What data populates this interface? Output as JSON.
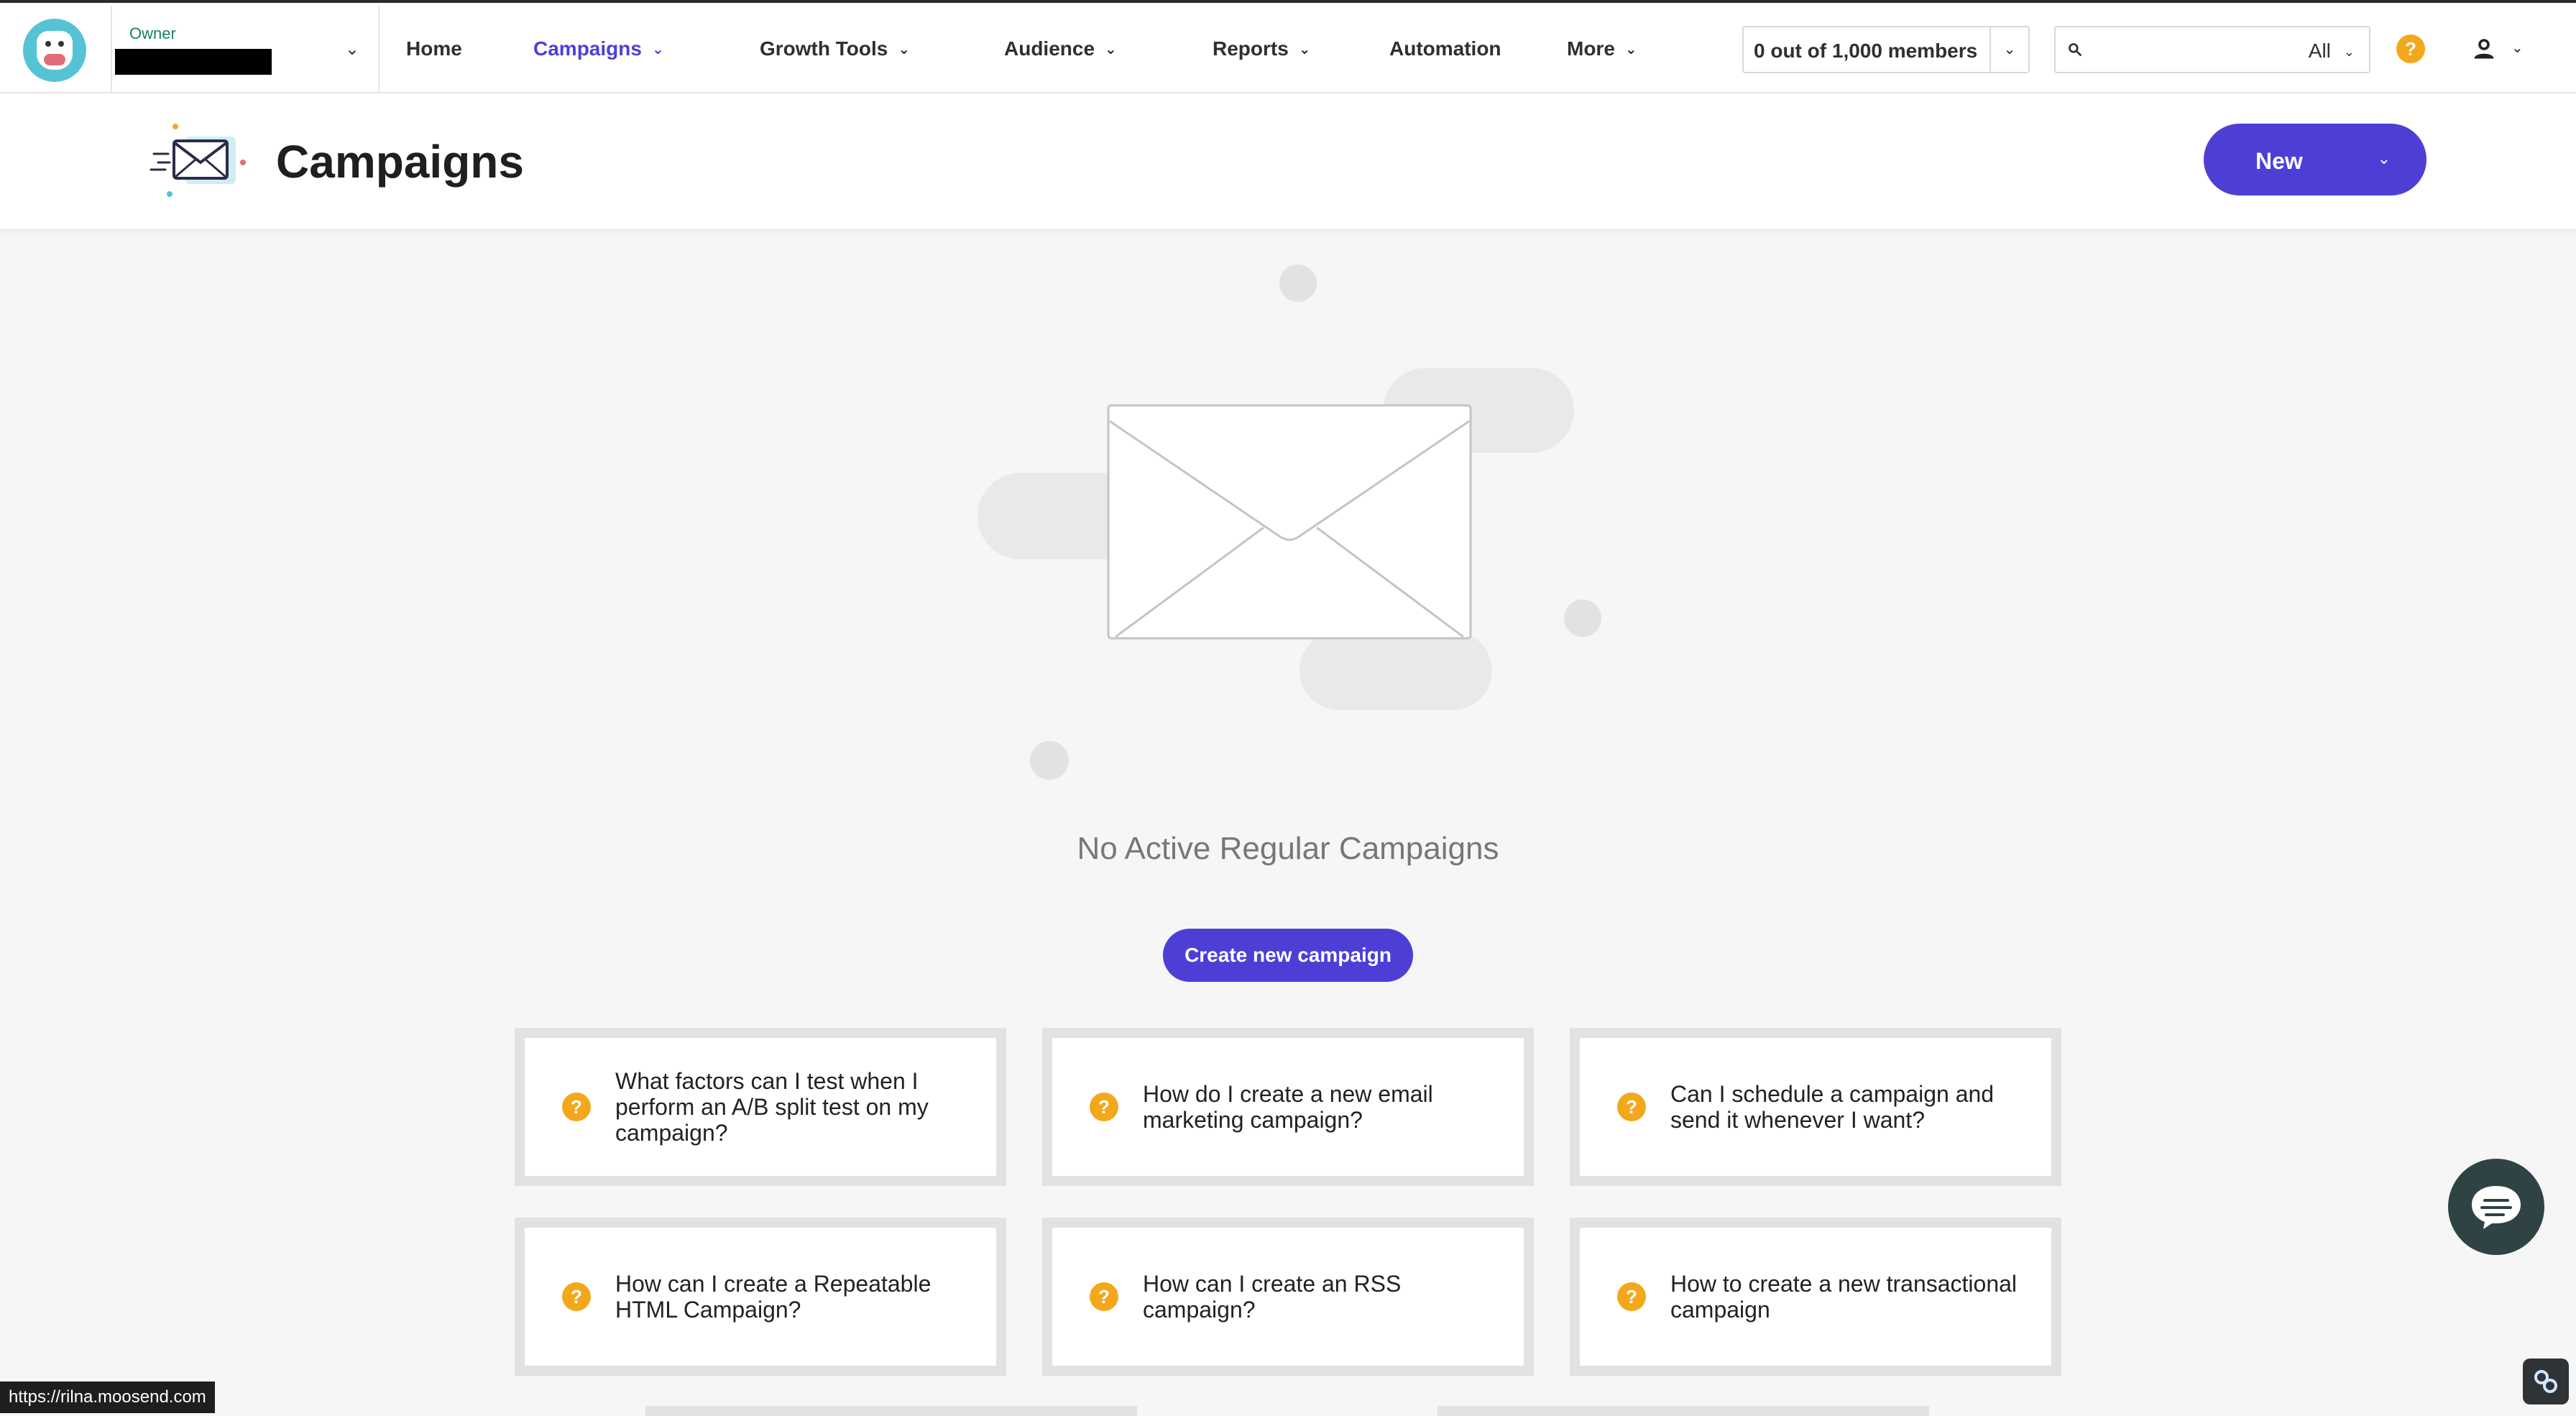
{
  "account": {
    "role": "Owner"
  },
  "nav": {
    "items": [
      {
        "label": "Home"
      },
      {
        "label": "Campaigns"
      },
      {
        "label": "Growth Tools"
      },
      {
        "label": "Audience"
      },
      {
        "label": "Reports"
      },
      {
        "label": "Automation"
      },
      {
        "label": "More"
      }
    ],
    "members": "0 out of 1,000 members",
    "search": {
      "placeholder": "",
      "filter": "All"
    },
    "help": "?"
  },
  "page": {
    "title": "Campaigns",
    "new_button": "New"
  },
  "empty_state": {
    "title": "No Active Regular Campaigns",
    "create_button": "Create new campaign"
  },
  "faq": [
    "What factors can I test when I perform an A/B split test on my campaign?",
    "How do I create a new email marketing campaign?",
    "Can I schedule a campaign and send it whenever I want?",
    "How can I create a Repeatable HTML Campaign?",
    "How can I create an RSS campaign?",
    "How to create a new transactional campaign"
  ],
  "status_bar": {
    "url": "https://rilna.moosend.com"
  },
  "colors": {
    "accent": "#4d3fd6",
    "help": "#f3a81c",
    "owner": "#19835e"
  }
}
